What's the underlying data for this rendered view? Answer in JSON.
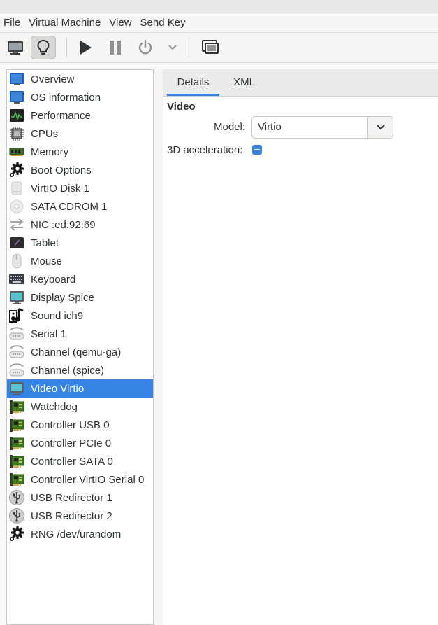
{
  "menu": [
    "File",
    "Virtual Machine",
    "View",
    "Send Key"
  ],
  "toolbar": {
    "icons": [
      "monitor-icon",
      "lightbulb-icon",
      "play-icon",
      "pause-icon",
      "power-icon",
      "chevron-down-icon",
      "console-icon"
    ],
    "active": "lightbulb-icon"
  },
  "sidebar": {
    "items": [
      {
        "label": "Overview",
        "icon": "overview-icon"
      },
      {
        "label": "OS information",
        "icon": "os-information-icon"
      },
      {
        "label": "Performance",
        "icon": "performance-icon"
      },
      {
        "label": "CPUs",
        "icon": "cpu-icon"
      },
      {
        "label": "Memory",
        "icon": "memory-icon"
      },
      {
        "label": "Boot Options",
        "icon": "gear-icon"
      },
      {
        "label": "VirtIO Disk 1",
        "icon": "disk-icon"
      },
      {
        "label": "SATA CDROM 1",
        "icon": "cdrom-icon"
      },
      {
        "label": "NIC :ed:92:69",
        "icon": "network-arrows-icon"
      },
      {
        "label": "Tablet",
        "icon": "tablet-icon"
      },
      {
        "label": "Mouse",
        "icon": "mouse-icon"
      },
      {
        "label": "Keyboard",
        "icon": "keyboard-icon"
      },
      {
        "label": "Display Spice",
        "icon": "display-icon"
      },
      {
        "label": "Sound ich9",
        "icon": "sound-icon"
      },
      {
        "label": "Serial 1",
        "icon": "serial-icon"
      },
      {
        "label": "Channel (qemu-ga)",
        "icon": "channel-icon"
      },
      {
        "label": "Channel (spice)",
        "icon": "channel-icon"
      },
      {
        "label": "Video Virtio",
        "icon": "display-icon"
      },
      {
        "label": "Watchdog",
        "icon": "controller-card-icon"
      },
      {
        "label": "Controller USB 0",
        "icon": "controller-card-icon"
      },
      {
        "label": "Controller PCIe 0",
        "icon": "controller-card-icon"
      },
      {
        "label": "Controller SATA 0",
        "icon": "controller-card-icon"
      },
      {
        "label": "Controller VirtIO Serial 0",
        "icon": "controller-card-icon"
      },
      {
        "label": "USB Redirector 1",
        "icon": "usb-icon"
      },
      {
        "label": "USB Redirector 2",
        "icon": "usb-icon"
      },
      {
        "label": "RNG /dev/urandom",
        "icon": "gear-icon"
      }
    ],
    "selected_index": 17
  },
  "tabs": {
    "details": "Details",
    "xml": "XML",
    "active": "Details"
  },
  "video": {
    "section_title": "Video",
    "model_label": "Model:",
    "model_value": "Virtio",
    "accel_label": "3D acceleration:",
    "accel_state": "indeterminate"
  },
  "colors": {
    "accent": "#3584e4",
    "window_bg": "#f6f5f4"
  }
}
